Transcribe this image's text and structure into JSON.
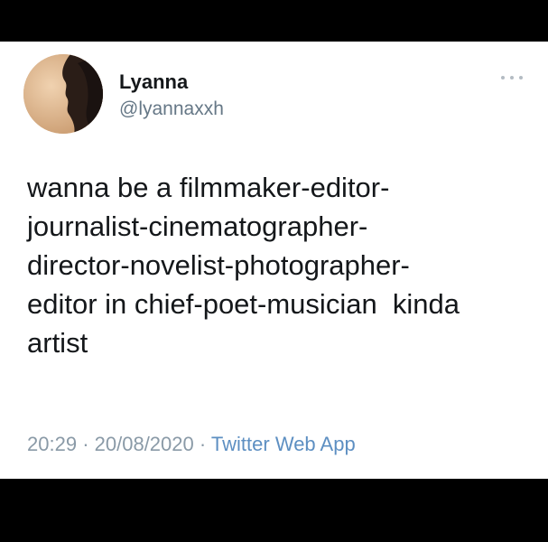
{
  "user": {
    "display_name": "Lyanna",
    "handle": "@lyannaxxh"
  },
  "tweet": {
    "lines": [
      "wanna be a filmmaker-editor-",
      "journalist-cinematographer-",
      "director-novelist-photographer-",
      "editor in chief-poet-musician  kinda",
      "artist"
    ],
    "time": "20:29",
    "separator": "·",
    "date": "20/08/2020",
    "source": "Twitter Web App"
  },
  "icons": {
    "more": "more-options-icon",
    "avatar": "avatar-image"
  },
  "colors": {
    "background_bars": "#000000",
    "card": "#ffffff",
    "text": "#14171a",
    "secondary": "#657786",
    "link": "#5d8fc2"
  }
}
